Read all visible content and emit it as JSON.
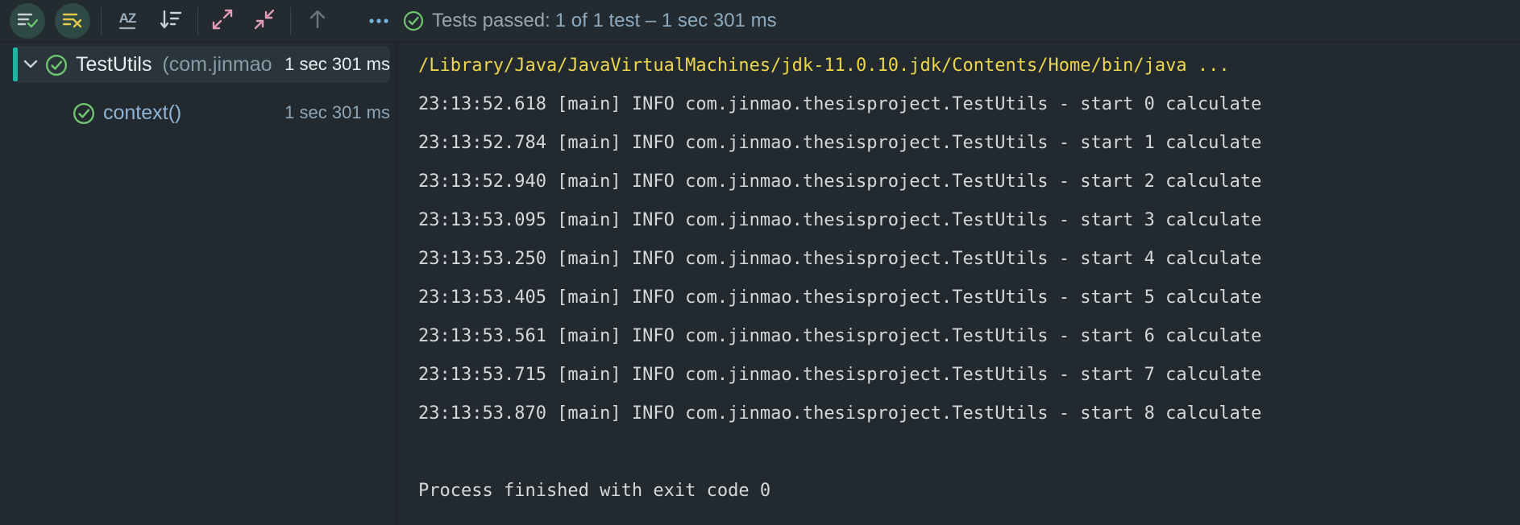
{
  "toolbar": {
    "buttons": [
      {
        "name": "show-passed-button",
        "icon": "list-check-icon",
        "active": true
      },
      {
        "name": "show-ignored-button",
        "icon": "list-x-icon",
        "active": true
      },
      {
        "name": "sort-alphabetically-button",
        "icon": "sort-az-icon",
        "glyph": "AZ"
      },
      {
        "name": "sort-by-duration-button",
        "icon": "sort-duration-icon"
      },
      {
        "name": "expand-all-button",
        "icon": "expand-icon"
      },
      {
        "name": "collapse-all-button",
        "icon": "collapse-icon"
      },
      {
        "name": "previous-failed-button",
        "icon": "arrow-up-icon"
      },
      {
        "name": "more-options-button",
        "icon": "more-icon"
      }
    ],
    "status": {
      "label": "Tests passed:",
      "count": "1 of 1 test – 1 sec 301 ms"
    }
  },
  "tree": {
    "items": [
      {
        "name": "TestUtils",
        "detail": "(com.jinmao",
        "time": "1 sec 301 ms",
        "selected": true,
        "expanded": true
      },
      {
        "name": "context()",
        "time": "1 sec 301 ms",
        "selected": false
      }
    ]
  },
  "console": {
    "command": "/Library/Java/JavaVirtualMachines/jdk-11.0.10.jdk/Contents/Home/bin/java ...",
    "lines": [
      "23:13:52.618 [main] INFO com.jinmao.thesisproject.TestUtils - start 0 calculate",
      "23:13:52.784 [main] INFO com.jinmao.thesisproject.TestUtils - start 1 calculate",
      "23:13:52.940 [main] INFO com.jinmao.thesisproject.TestUtils - start 2 calculate",
      "23:13:53.095 [main] INFO com.jinmao.thesisproject.TestUtils - start 3 calculate",
      "23:13:53.250 [main] INFO com.jinmao.thesisproject.TestUtils - start 4 calculate",
      "23:13:53.405 [main] INFO com.jinmao.thesisproject.TestUtils - start 5 calculate",
      "23:13:53.561 [main] INFO com.jinmao.thesisproject.TestUtils - start 6 calculate",
      "23:13:53.715 [main] INFO com.jinmao.thesisproject.TestUtils - start 7 calculate",
      "23:13:53.870 [main] INFO com.jinmao.thesisproject.TestUtils - start 8 calculate"
    ],
    "footer": "Process finished with exit code 0"
  },
  "colors": {
    "background": "#222a30",
    "accent": "#1fb3a0",
    "passed": "#6fc46f",
    "command": "#ecd64d",
    "console_text": "#d4d8dc"
  }
}
